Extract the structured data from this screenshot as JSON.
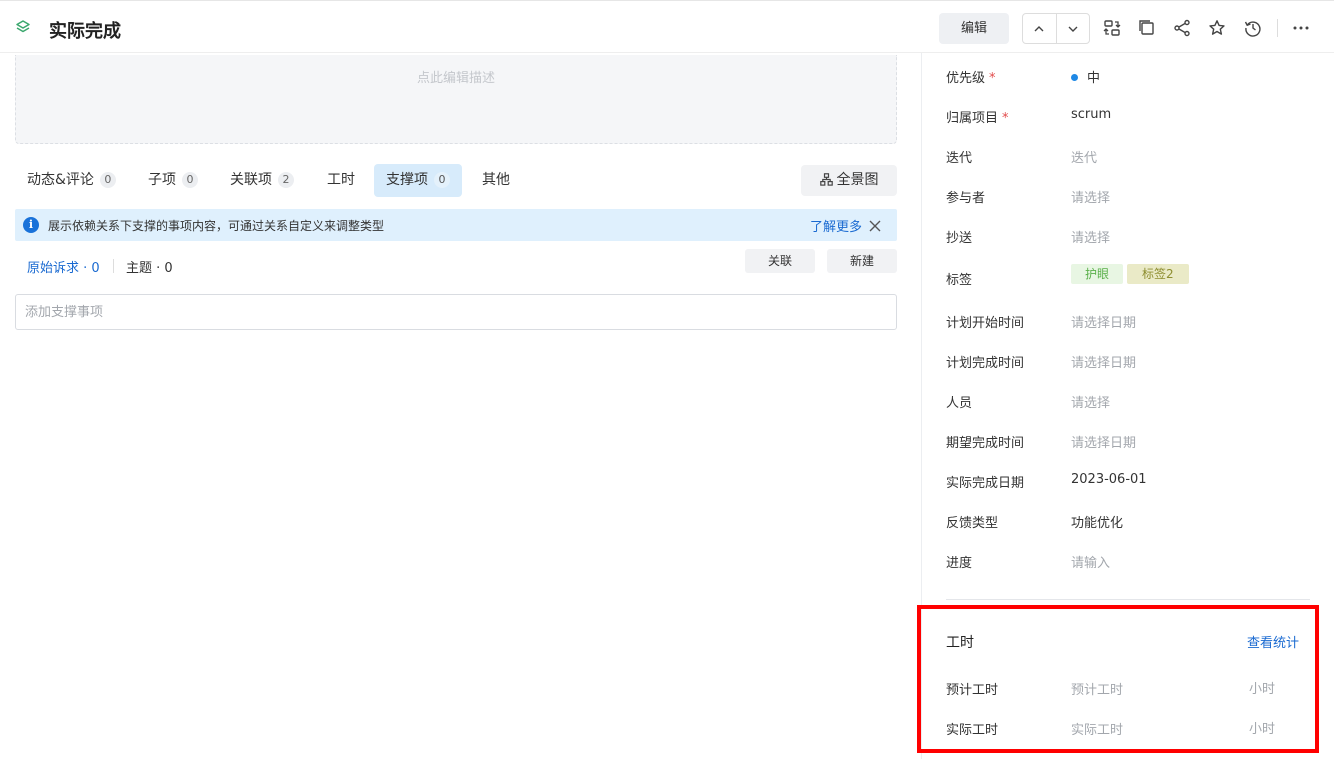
{
  "header": {
    "title": "实际完成",
    "edit_label": "编辑"
  },
  "description": {
    "placeholder": "点此编辑描述"
  },
  "tabs": [
    {
      "label": "动态&评论",
      "count": "0"
    },
    {
      "label": "子项",
      "count": "0"
    },
    {
      "label": "关联项",
      "count": "2"
    },
    {
      "label": "工时",
      "count": ""
    },
    {
      "label": "支撑项",
      "count": "0"
    },
    {
      "label": "其他",
      "count": ""
    }
  ],
  "panorama_label": "全景图",
  "alert": {
    "message": "展示依赖关系下支撑的事项内容，可通过关系自定义来调整类型",
    "learn_more": "了解更多"
  },
  "subtabs": {
    "original": "原始诉求 · 0",
    "topic": "主题 · 0"
  },
  "actions": {
    "link_label": "关联",
    "new_label": "新建"
  },
  "add_input": {
    "placeholder": "添加支撑事项"
  },
  "properties": {
    "priority": {
      "label": "优先级",
      "value": "中"
    },
    "project": {
      "label": "归属项目",
      "value": "scrum"
    },
    "iteration": {
      "label": "迭代",
      "value": "迭代"
    },
    "participants": {
      "label": "参与者",
      "value": "请选择"
    },
    "cc": {
      "label": "抄送",
      "value": "请选择"
    },
    "tags": {
      "label": "标签",
      "values": [
        "护眼",
        "标签2"
      ]
    },
    "plan_start": {
      "label": "计划开始时间",
      "value": "请选择日期"
    },
    "plan_end": {
      "label": "计划完成时间",
      "value": "请选择日期"
    },
    "person": {
      "label": "人员",
      "value": "请选择"
    },
    "expected_end": {
      "label": "期望完成时间",
      "value": "请选择日期"
    },
    "actual_end": {
      "label": "实际完成日期",
      "value": "2023-06-01"
    },
    "feedback_type": {
      "label": "反馈类型",
      "value": "功能优化"
    },
    "progress": {
      "label": "进度",
      "value": "请输入"
    }
  },
  "workhours": {
    "title": "工时",
    "stats_link": "查看统计",
    "estimated": {
      "label": "预计工时",
      "value": "预计工时",
      "unit": "小时"
    },
    "actual": {
      "label": "实际工时",
      "value": "实际工时",
      "unit": "小时"
    }
  },
  "colors": {
    "accent": "#1a6ad1",
    "required": "#e24a4a",
    "highlight_box": "#ff0000",
    "priority_dot": "#1e88e5"
  }
}
